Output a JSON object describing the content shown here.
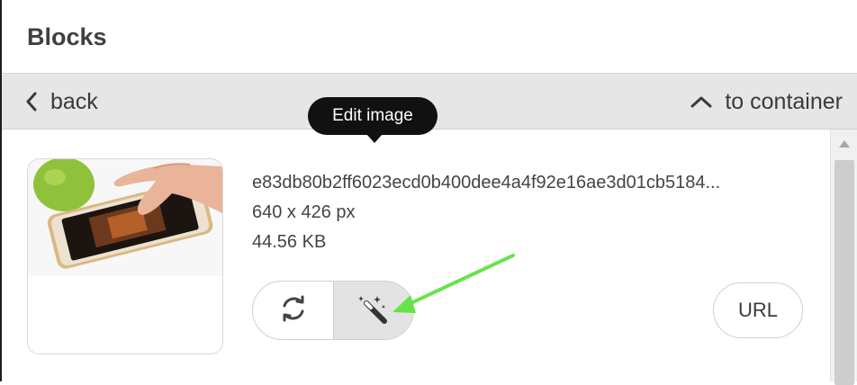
{
  "panel": {
    "title": "Blocks"
  },
  "nav": {
    "back_label": "back",
    "container_label": "to container"
  },
  "image_info": {
    "filename": "e83db80b2ff6023ecd0b400dee4a4f92e16ae3d01cb5184...",
    "dimensions": "640 x 426 px",
    "size": "44.56 KB"
  },
  "tooltip": {
    "text": "Edit image"
  },
  "buttons": {
    "replace_icon": "refresh-icon",
    "edit_icon": "magic-wand-icon",
    "url_label": "URL"
  },
  "colors": {
    "annotation_arrow": "#66e34a",
    "tooltip_bg": "#111111",
    "navbar_bg": "#e6e6e6"
  }
}
